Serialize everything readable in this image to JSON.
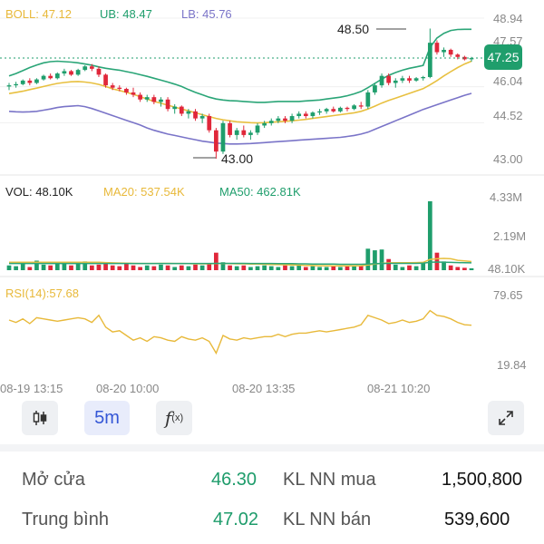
{
  "colors": {
    "up": "#1f9e6c",
    "down": "#e0273a",
    "ma_yellow": "#e8c040",
    "boll_green": "#2aa577",
    "lower_purple": "#7a74c8",
    "rsi_line": "#e8b93a",
    "accent_blue": "#3557d6"
  },
  "legends": {
    "boll": "BOLL: 47.12",
    "ub": "UB: 48.47",
    "lb": "LB: 45.76",
    "vol": "VOL: 48.10K",
    "ma20": "MA20: 537.54K",
    "ma50": "MA50: 462.81K",
    "rsi": "RSI(14):57.68"
  },
  "price_axis": [
    "48.94",
    "47.57",
    "46.04",
    "44.52",
    "43.00"
  ],
  "current_price": "47.25",
  "high_label": "48.50",
  "low_label": "43.00",
  "volume_axis": [
    "4.33M",
    "2.19M",
    "48.10K"
  ],
  "rsi_axis": [
    "79.65",
    "19.84"
  ],
  "time_labels": [
    "08-19 13:15",
    "08-20 10:00",
    "08-20 13:35",
    "08-21 10:20"
  ],
  "toolbar": {
    "candle_icon": "candlestick-icon",
    "interval": "5m",
    "indicator_icon": "function-icon",
    "expand_icon": "expand-icon"
  },
  "stats": {
    "open_label": "Mở cửa",
    "open_value": "46.30",
    "avg_label": "Trung bình",
    "avg_value": "47.02",
    "buy_label": "KL NN mua",
    "buy_value": "1,500,800",
    "sell_label": "KL NN bán",
    "sell_value": "539,600"
  },
  "chart_data": [
    {
      "type": "candlestick",
      "title": "",
      "ylim": [
        43.0,
        48.94
      ],
      "candles": [
        [
          46.05,
          46.2,
          45.9,
          46.1
        ],
        [
          46.1,
          46.25,
          46.0,
          46.15
        ],
        [
          46.15,
          46.35,
          46.1,
          46.3
        ],
        [
          46.3,
          46.4,
          46.1,
          46.2
        ],
        [
          46.2,
          46.4,
          46.15,
          46.35
        ],
        [
          46.35,
          46.55,
          46.3,
          46.5
        ],
        [
          46.5,
          46.6,
          46.35,
          46.4
        ],
        [
          46.4,
          46.65,
          46.35,
          46.6
        ],
        [
          46.6,
          46.8,
          46.5,
          46.7
        ],
        [
          46.7,
          46.75,
          46.5,
          46.55
        ],
        [
          46.55,
          46.8,
          46.5,
          46.75
        ],
        [
          46.75,
          46.95,
          46.7,
          46.9
        ],
        [
          46.9,
          47.0,
          46.7,
          46.8
        ],
        [
          46.8,
          46.9,
          46.45,
          46.55
        ],
        [
          46.55,
          46.6,
          46.0,
          46.1
        ],
        [
          46.1,
          46.2,
          45.9,
          46.0
        ],
        [
          46.0,
          46.1,
          45.85,
          45.95
        ],
        [
          45.95,
          46.0,
          45.7,
          45.8
        ],
        [
          45.8,
          46.0,
          45.6,
          45.7
        ],
        [
          45.7,
          45.8,
          45.4,
          45.5
        ],
        [
          45.5,
          45.7,
          45.4,
          45.6
        ],
        [
          45.6,
          45.7,
          45.3,
          45.4
        ],
        [
          45.4,
          45.6,
          45.2,
          45.5
        ],
        [
          45.5,
          45.6,
          45.0,
          45.1
        ],
        [
          45.1,
          45.3,
          44.9,
          45.2
        ],
        [
          45.2,
          45.25,
          44.8,
          44.9
        ],
        [
          44.9,
          45.1,
          44.7,
          45.0
        ],
        [
          45.0,
          45.1,
          44.6,
          44.7
        ],
        [
          44.7,
          44.9,
          44.5,
          44.8
        ],
        [
          44.8,
          44.9,
          44.1,
          44.2
        ],
        [
          44.2,
          44.3,
          43.0,
          43.3
        ],
        [
          43.3,
          44.6,
          43.2,
          44.5
        ],
        [
          44.5,
          44.6,
          43.9,
          44.0
        ],
        [
          44.0,
          44.3,
          43.8,
          44.2
        ],
        [
          44.2,
          44.4,
          43.9,
          44.0
        ],
        [
          44.0,
          44.2,
          43.8,
          44.1
        ],
        [
          44.1,
          44.5,
          44.0,
          44.4
        ],
        [
          44.4,
          44.6,
          44.3,
          44.5
        ],
        [
          44.5,
          44.7,
          44.4,
          44.6
        ],
        [
          44.6,
          44.8,
          44.5,
          44.7
        ],
        [
          44.7,
          44.8,
          44.5,
          44.6
        ],
        [
          44.6,
          44.9,
          44.5,
          44.8
        ],
        [
          44.8,
          45.0,
          44.7,
          44.9
        ],
        [
          44.9,
          45.0,
          44.7,
          44.8
        ],
        [
          44.8,
          45.0,
          44.7,
          44.95
        ],
        [
          44.95,
          45.1,
          44.85,
          45.0
        ],
        [
          45.0,
          45.15,
          44.9,
          45.1
        ],
        [
          45.1,
          45.2,
          44.95,
          45.0
        ],
        [
          45.0,
          45.2,
          44.95,
          45.15
        ],
        [
          45.15,
          45.2,
          45.0,
          45.1
        ],
        [
          45.1,
          45.3,
          45.05,
          45.25
        ],
        [
          45.25,
          45.4,
          45.1,
          45.2
        ],
        [
          45.2,
          45.9,
          45.1,
          45.8
        ],
        [
          45.8,
          46.2,
          45.7,
          46.1
        ],
        [
          46.1,
          46.6,
          46.0,
          46.5
        ],
        [
          46.5,
          46.6,
          46.1,
          46.2
        ],
        [
          46.2,
          46.4,
          46.0,
          46.3
        ],
        [
          46.3,
          46.5,
          46.2,
          46.4
        ],
        [
          46.4,
          46.5,
          46.2,
          46.3
        ],
        [
          46.3,
          46.45,
          46.25,
          46.4
        ],
        [
          46.4,
          46.5,
          46.3,
          46.45
        ],
        [
          46.45,
          48.5,
          46.4,
          47.9
        ],
        [
          47.9,
          48.0,
          47.4,
          47.5
        ],
        [
          47.5,
          47.7,
          47.3,
          47.6
        ],
        [
          47.6,
          47.65,
          47.3,
          47.4
        ],
        [
          47.4,
          47.45,
          47.2,
          47.3
        ],
        [
          47.3,
          47.35,
          47.15,
          47.2
        ],
        [
          47.2,
          47.3,
          47.1,
          47.25
        ]
      ],
      "bands": {
        "middle": [
          45.75,
          45.8,
          45.85,
          45.92,
          45.98,
          46.05,
          46.12,
          46.18,
          46.22,
          46.25,
          46.26,
          46.24,
          46.2,
          46.14,
          46.05,
          45.95,
          45.88,
          45.8,
          45.72,
          45.62,
          45.52,
          45.42,
          45.34,
          45.26,
          45.18,
          45.1,
          45.02,
          44.94,
          44.86,
          44.78,
          44.7,
          44.64,
          44.6,
          44.56,
          44.54,
          44.52,
          44.51,
          44.52,
          44.54,
          44.56,
          44.58,
          44.6,
          44.63,
          44.66,
          44.7,
          44.74,
          44.78,
          44.82,
          44.86,
          44.9,
          44.94,
          45.0,
          45.1,
          45.22,
          45.35,
          45.46,
          45.56,
          45.66,
          45.76,
          45.86,
          45.96,
          46.12,
          46.3,
          46.5,
          46.68,
          46.85,
          47.0,
          47.12
        ],
        "upper": [
          46.5,
          46.6,
          46.72,
          46.85,
          46.96,
          47.05,
          47.1,
          47.12,
          47.1,
          47.08,
          47.05,
          47.0,
          46.95,
          46.88,
          46.82,
          46.78,
          46.74,
          46.68,
          46.62,
          46.55,
          46.48,
          46.4,
          46.32,
          46.24,
          46.15,
          46.05,
          45.92,
          45.8,
          45.7,
          45.6,
          45.52,
          45.48,
          45.45,
          45.44,
          45.42,
          45.4,
          45.38,
          45.38,
          45.4,
          45.42,
          45.42,
          45.42,
          45.42,
          45.44,
          45.46,
          45.48,
          45.52,
          45.56,
          45.6,
          45.66,
          45.74,
          45.84,
          46.0,
          46.18,
          46.36,
          46.52,
          46.64,
          46.74,
          46.82,
          46.88,
          46.94,
          47.7,
          48.1,
          48.3,
          48.42,
          48.46,
          48.47,
          48.47
        ],
        "lower": [
          45.0,
          44.98,
          44.97,
          44.98,
          45.0,
          45.05,
          45.1,
          45.16,
          45.2,
          45.22,
          45.24,
          45.2,
          45.12,
          45.02,
          44.92,
          44.82,
          44.72,
          44.62,
          44.52,
          44.42,
          44.3,
          44.2,
          44.12,
          44.04,
          43.98,
          43.92,
          43.86,
          43.8,
          43.74,
          43.7,
          43.66,
          43.64,
          43.62,
          43.62,
          43.63,
          43.64,
          43.66,
          43.68,
          43.7,
          43.72,
          43.74,
          43.76,
          43.78,
          43.8,
          43.82,
          43.84,
          43.86,
          43.88,
          43.9,
          43.94,
          43.98,
          44.04,
          44.12,
          44.24,
          44.36,
          44.48,
          44.6,
          44.72,
          44.84,
          44.96,
          45.08,
          45.18,
          45.28,
          45.38,
          45.48,
          45.58,
          45.68,
          45.76
        ]
      }
    },
    {
      "type": "bar",
      "title": "",
      "ylim": [
        0,
        4.33
      ],
      "unit": "M",
      "values": [
        0.3,
        0.25,
        0.5,
        0.2,
        0.6,
        0.35,
        0.3,
        0.45,
        0.5,
        0.3,
        0.4,
        0.55,
        0.3,
        0.35,
        0.4,
        0.3,
        0.25,
        0.45,
        0.3,
        0.2,
        0.3,
        0.25,
        0.35,
        0.3,
        0.2,
        0.3,
        0.25,
        0.35,
        0.3,
        0.4,
        1.1,
        0.5,
        0.3,
        0.25,
        0.3,
        0.2,
        0.25,
        0.3,
        0.25,
        0.2,
        0.3,
        0.25,
        0.3,
        0.2,
        0.25,
        0.2,
        0.2,
        0.25,
        0.2,
        0.3,
        0.25,
        0.3,
        1.35,
        1.25,
        1.3,
        0.7,
        0.35,
        0.2,
        0.3,
        0.25,
        0.45,
        4.33,
        1.1,
        0.55,
        0.3,
        0.2,
        0.15,
        0.12
      ],
      "ma20": [
        0.5,
        0.5,
        0.5,
        0.5,
        0.5,
        0.5,
        0.5,
        0.5,
        0.5,
        0.5,
        0.5,
        0.5,
        0.5,
        0.5,
        0.48,
        0.46,
        0.45,
        0.44,
        0.43,
        0.42,
        0.42,
        0.42,
        0.43,
        0.43,
        0.42,
        0.42,
        0.41,
        0.4,
        0.4,
        0.4,
        0.42,
        0.42,
        0.41,
        0.4,
        0.4,
        0.39,
        0.38,
        0.37,
        0.36,
        0.35,
        0.34,
        0.33,
        0.32,
        0.3,
        0.29,
        0.28,
        0.28,
        0.27,
        0.27,
        0.27,
        0.27,
        0.28,
        0.33,
        0.38,
        0.43,
        0.46,
        0.47,
        0.47,
        0.47,
        0.48,
        0.49,
        0.68,
        0.72,
        0.74,
        0.72,
        0.62,
        0.58,
        0.54
      ],
      "ma50": [
        0.42,
        0.42,
        0.42,
        0.42,
        0.42,
        0.42,
        0.42,
        0.42,
        0.42,
        0.42,
        0.42,
        0.42,
        0.42,
        0.42,
        0.42,
        0.42,
        0.42,
        0.42,
        0.42,
        0.42,
        0.42,
        0.42,
        0.42,
        0.42,
        0.42,
        0.42,
        0.42,
        0.42,
        0.42,
        0.42,
        0.43,
        0.43,
        0.43,
        0.43,
        0.43,
        0.42,
        0.42,
        0.42,
        0.42,
        0.41,
        0.41,
        0.41,
        0.4,
        0.4,
        0.39,
        0.39,
        0.38,
        0.38,
        0.37,
        0.37,
        0.37,
        0.37,
        0.39,
        0.41,
        0.42,
        0.43,
        0.43,
        0.43,
        0.43,
        0.43,
        0.44,
        0.5,
        0.51,
        0.5,
        0.49,
        0.48,
        0.47,
        0.46
      ]
    },
    {
      "type": "line",
      "title": "",
      "ylim": [
        19.84,
        79.65
      ],
      "values": [
        62,
        60,
        63,
        59,
        64,
        63,
        62,
        61,
        62,
        63,
        64,
        63,
        60,
        66,
        56,
        52,
        53,
        49,
        45,
        47,
        44,
        48,
        47,
        45,
        44,
        48,
        46,
        45,
        47,
        44,
        34,
        49,
        46,
        45,
        47,
        46,
        47,
        48,
        48,
        50,
        48,
        50,
        51,
        51,
        52,
        53,
        52,
        53,
        54,
        55,
        56,
        58,
        66,
        64,
        62,
        59,
        60,
        62,
        60,
        61,
        63,
        70,
        66,
        65,
        63,
        60,
        58,
        57.68
      ]
    }
  ]
}
